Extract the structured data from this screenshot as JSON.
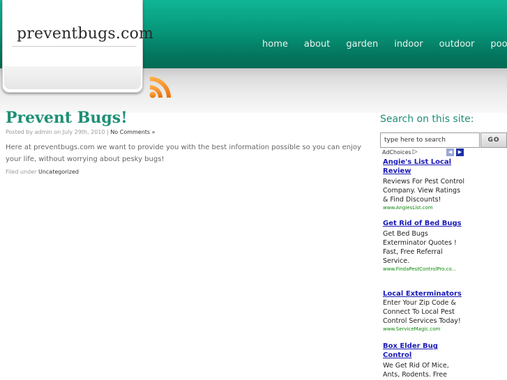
{
  "header": {
    "site_title": "preventbugs.com",
    "nav": [
      "home",
      "about",
      "garden",
      "indoor",
      "outdoor",
      "pool"
    ]
  },
  "post": {
    "title": "Prevent Bugs!",
    "meta_prefix": "Posted by admin on July 29th, 2010 |",
    "meta_comments": "No Comments »",
    "body": "Here at preventbugs.com we want to provide you with the best information possible so you can enjoy your life, without worrying about pesky bugs!",
    "filed_prefix": "Filed under",
    "filed_category": "Uncategorized"
  },
  "sidebar": {
    "search_heading": "Search on this site:",
    "search_placeholder": "type here to search",
    "search_button": "GO",
    "adchoices_label": "AdChoices",
    "ads": [
      {
        "title": "Angie's List Local Review",
        "text": "Reviews For Pest Control Company. View Ratings & Find Discounts!",
        "url": "www.AngiesList.com"
      },
      {
        "title": "Get Rid of Bed Bugs",
        "text": "Get Bed Bugs Exterminator Quotes ! Fast, Free Referral Service.",
        "url": "www.FindaPestControlPro.co..."
      },
      {
        "title": "Local Exterminators",
        "text": "Enter Your Zip Code & Connect To Local Pest Control Services Today!",
        "url": "www.ServiceMagic.com"
      },
      {
        "title": "Box Elder Bug Control",
        "text": "We Get Rid Of Mice, Ants, Rodents. Free Consultations. Free",
        "url": ""
      }
    ]
  },
  "colors": {
    "header_green": "#06977a",
    "title_green": "#1e8f76",
    "ad_link_blue": "#1a1ab8",
    "ad_url_green": "#0b8a0b",
    "rss_orange": "#f28a1a"
  },
  "icons": {
    "rss": "rss-feed-icon",
    "adchoices": "adchoices-triangle-icon",
    "prev": "chevron-left-icon",
    "next": "chevron-right-icon"
  }
}
